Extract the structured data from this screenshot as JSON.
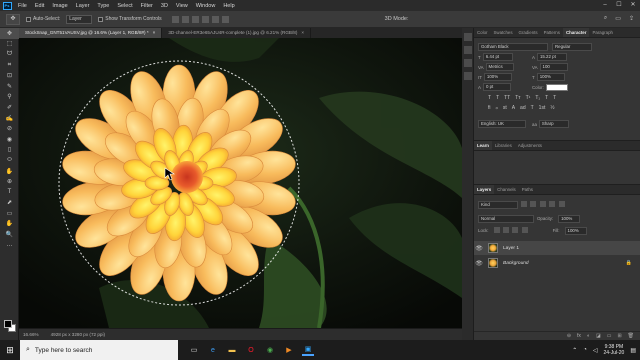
{
  "app": {
    "logo_text": "Ps",
    "menu": [
      "File",
      "Edit",
      "Image",
      "Layer",
      "Type",
      "Select",
      "Filter",
      "3D",
      "View",
      "Window",
      "Help"
    ],
    "window_controls": [
      "–",
      "☐",
      "✕"
    ]
  },
  "options": {
    "tool_glyph": "✥",
    "auto_select_label": "Auto-Select:",
    "auto_select_value": "Layer",
    "transform_controls_label": "Show Transform Controls",
    "mode_3d_label": "3D Mode:"
  },
  "tools": [
    "✥",
    "⬚",
    "ᗢ",
    "⌗",
    "⊡",
    "✎",
    "⚲",
    "✐",
    "✍",
    "⊘",
    "◉",
    "▯",
    "⬭",
    "✋",
    "⊕",
    "T",
    "⬈",
    "▭",
    "✋",
    "🔍",
    "…"
  ],
  "documents": [
    {
      "title": "StockSnap_GNT51VAUSV.jpg @ 16.6% (Layer 1, RGB/8#) *",
      "active": true
    },
    {
      "title": "3D-channel-ER3e65AJU4R-complete (1).jpg @ 6.21% (RGB/8)",
      "active": false
    }
  ],
  "status": {
    "zoom": "16.66%",
    "doc_size": "4928 px x 3280 px (72 ppi)"
  },
  "character_panel": {
    "tabs": [
      {
        "label": "Color",
        "active": false
      },
      {
        "label": "Swatches",
        "active": false
      },
      {
        "label": "Gradients",
        "active": false
      },
      {
        "label": "Patterns",
        "active": false
      },
      {
        "label": "Character",
        "active": true
      },
      {
        "label": "Paragraph",
        "active": false
      }
    ],
    "font_family": "Gotham Black",
    "font_style": "Regular",
    "font_size": "6.44 pt",
    "leading": "15.22 pt",
    "kerning": "Metrics",
    "tracking": "100",
    "vertical_scale": "100%",
    "horizontal_scale": "100%",
    "baseline_shift": "0 pt",
    "color_label": "Color:",
    "color_value": "#ffffff",
    "type_buttons": [
      "T",
      "T",
      "TT",
      "Tт",
      "T¹",
      "T₁",
      "T",
      "T"
    ],
    "opentype_buttons": [
      "fi",
      "ℴ",
      "st",
      "A",
      "ad",
      "T",
      "1st",
      "½"
    ],
    "language": "English: UK",
    "antialias_icon": "aa",
    "antialias": "Sharp"
  },
  "learn_panel": {
    "tabs": [
      {
        "label": "Learn",
        "active": true
      },
      {
        "label": "Libraries",
        "active": false
      },
      {
        "label": "Adjustments",
        "active": false
      }
    ]
  },
  "layers_panel": {
    "tabs": [
      {
        "label": "Layers",
        "active": true
      },
      {
        "label": "Channels",
        "active": false
      },
      {
        "label": "Paths",
        "active": false
      }
    ],
    "filter_kind": "Kind",
    "blend_mode": "Normal",
    "opacity_label": "Opacity:",
    "opacity": "100%",
    "lock_label": "Lock:",
    "fill_label": "Fill:",
    "fill": "100%",
    "layers": [
      {
        "name": "Layer 1",
        "selected": true,
        "italic": false,
        "locked": false
      },
      {
        "name": "Background",
        "selected": false,
        "italic": true,
        "locked": true
      }
    ],
    "footer_icons": [
      "⊖",
      "fx",
      "◐",
      "◪",
      "▭",
      "⊞",
      "🗑"
    ]
  },
  "taskbar": {
    "search_placeholder": "Type here to search",
    "time": "9:38 PM",
    "date": "24-Jul-20"
  }
}
